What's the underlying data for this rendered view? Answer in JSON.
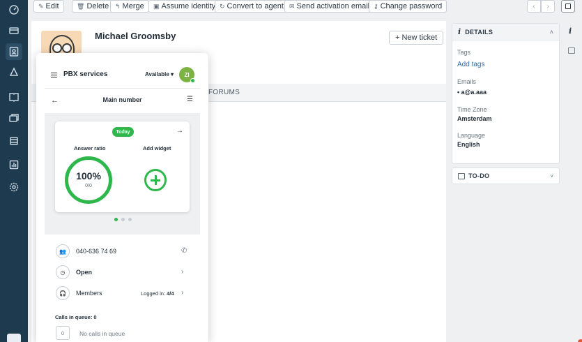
{
  "toolbar": {
    "buttons": [
      {
        "icon": "edit-icon",
        "label": "Edit"
      },
      {
        "icon": "trash-icon",
        "label": "Delete"
      },
      {
        "icon": "merge-icon",
        "label": "Merge"
      },
      {
        "icon": "identity-icon",
        "label": "Assume identity"
      },
      {
        "icon": "convert-icon",
        "label": "Convert to agent"
      },
      {
        "icon": "mail-icon",
        "label": "Send activation email"
      },
      {
        "icon": "key-icon",
        "label": "Change password"
      }
    ],
    "prev": "‹",
    "next": "›"
  },
  "profile": {
    "name": "Michael Groomsby",
    "new_ticket": "+ New ticket",
    "tab_partial": "FORUMS"
  },
  "details": {
    "title": "DETAILS",
    "tags_label": "Tags",
    "add_tags": "Add tags",
    "emails_label": "Emails",
    "email": "• a@a.aaa",
    "timezone_label": "Time Zone",
    "timezone": "Amsterdam",
    "language_label": "Language",
    "language": "English"
  },
  "todo": {
    "title": "TO-DO"
  },
  "pbx": {
    "title": "PBX services",
    "status": "Available ▾",
    "avatar_initials": "ZI",
    "sub_title": "Main number",
    "today_badge": "Today",
    "answer_ratio_label": "Answer ratio",
    "add_widget_label": "Add widget",
    "answer_ratio_value": "100%",
    "answer_ratio_fraction": "0/0",
    "answer_ratio": 1.0,
    "carousel_dots": 3,
    "phone": "040-636 74 69",
    "state": "Open",
    "members": "Members",
    "logged_in_label": "Logged in:",
    "logged_in_value": "4/4",
    "calls_in_queue": "Calls in queue:  0",
    "queue_count": "0",
    "no_calls": "No calls in queue"
  },
  "colors": {
    "nav_bg": "#1e3a4f",
    "accent_green": "#2eb84c",
    "link_blue": "#2b6cb0"
  }
}
